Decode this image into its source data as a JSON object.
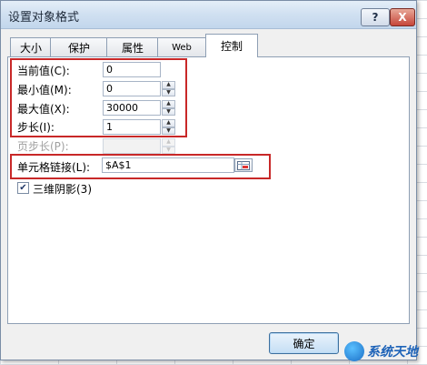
{
  "window": {
    "title": "设置对象格式",
    "help_label": "?",
    "close_label": "X"
  },
  "tabs": [
    {
      "label": "大小",
      "active": false
    },
    {
      "label": "保护",
      "active": false
    },
    {
      "label": "属性",
      "active": false
    },
    {
      "label": "Web",
      "active": false
    },
    {
      "label": "控制",
      "active": true
    }
  ],
  "controls": {
    "current_value": {
      "label": "当前值(C):",
      "value": "0"
    },
    "min_value": {
      "label": "最小值(M):",
      "value": "0"
    },
    "max_value": {
      "label": "最大值(X):",
      "value": "30000"
    },
    "step": {
      "label": "步长(I):",
      "value": "1"
    },
    "page_step": {
      "label": "页步长(P):",
      "value": ""
    },
    "cell_link": {
      "label": "单元格链接(L):",
      "value": "$A$1"
    },
    "shading_3d": {
      "label": "三维阴影(3)",
      "checked": true
    }
  },
  "buttons": {
    "ok_label": "确定"
  },
  "watermark": {
    "text": "系统天地"
  },
  "colors": {
    "highlight_box": "#c82828",
    "accent": "#1e63b8"
  }
}
